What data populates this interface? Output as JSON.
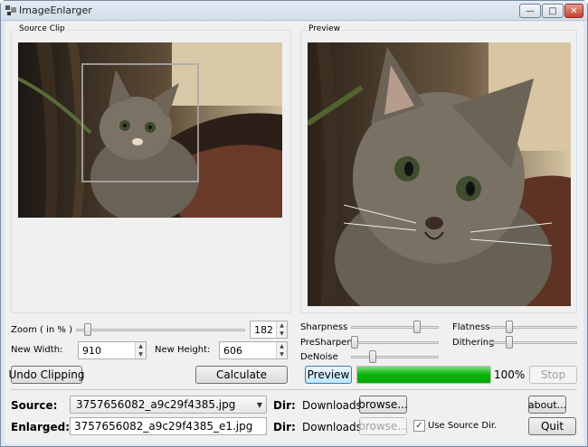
{
  "window": {
    "title": "ImageEnlarger"
  },
  "source_clip": {
    "label": "Source Clip"
  },
  "preview_panel": {
    "label": "Preview"
  },
  "zoom": {
    "label": "Zoom ( in % )",
    "value": "182",
    "slider_fraction": 0.05
  },
  "new_width": {
    "label": "New Width:",
    "value": "910"
  },
  "new_height": {
    "label": "New Height:",
    "value": "606"
  },
  "buttons": {
    "undo_clipping": "Undo Clipping",
    "calculate": "Calculate",
    "preview": "Preview",
    "stop": "Stop",
    "browse_source": "browse...",
    "browse_enlarged": "browse...",
    "about": "about...",
    "quit": "Quit"
  },
  "sliders": {
    "sharpness": {
      "label": "Sharpness",
      "level": 0.78
    },
    "presharpen": {
      "label": "PreSharpen",
      "level": 0.0
    },
    "denoise": {
      "label": "DeNoise",
      "level": 0.22
    },
    "flatness": {
      "label": "Flatness",
      "level": 0.2
    },
    "dithering": {
      "label": "Dithering",
      "level": 0.2
    }
  },
  "progress": {
    "percent_text": "100%",
    "value": 100
  },
  "source": {
    "label": "Source:",
    "file": "3757656082_a9c29f4385.jpg",
    "dir_label": "Dir:",
    "dir_value": "Downloads"
  },
  "enlarged": {
    "label": "Enlarged:",
    "file": "3757656082_a9c29f4385_e1.jpg",
    "dir_label": "Dir:",
    "dir_value": "Downloads"
  },
  "use_source_dir": {
    "label": "Use Source Dir.",
    "checked": true
  },
  "colors": {
    "progress_green": "#06b006",
    "window_frame": "#dfe6ee",
    "client_bg": "#f0f0f0"
  }
}
